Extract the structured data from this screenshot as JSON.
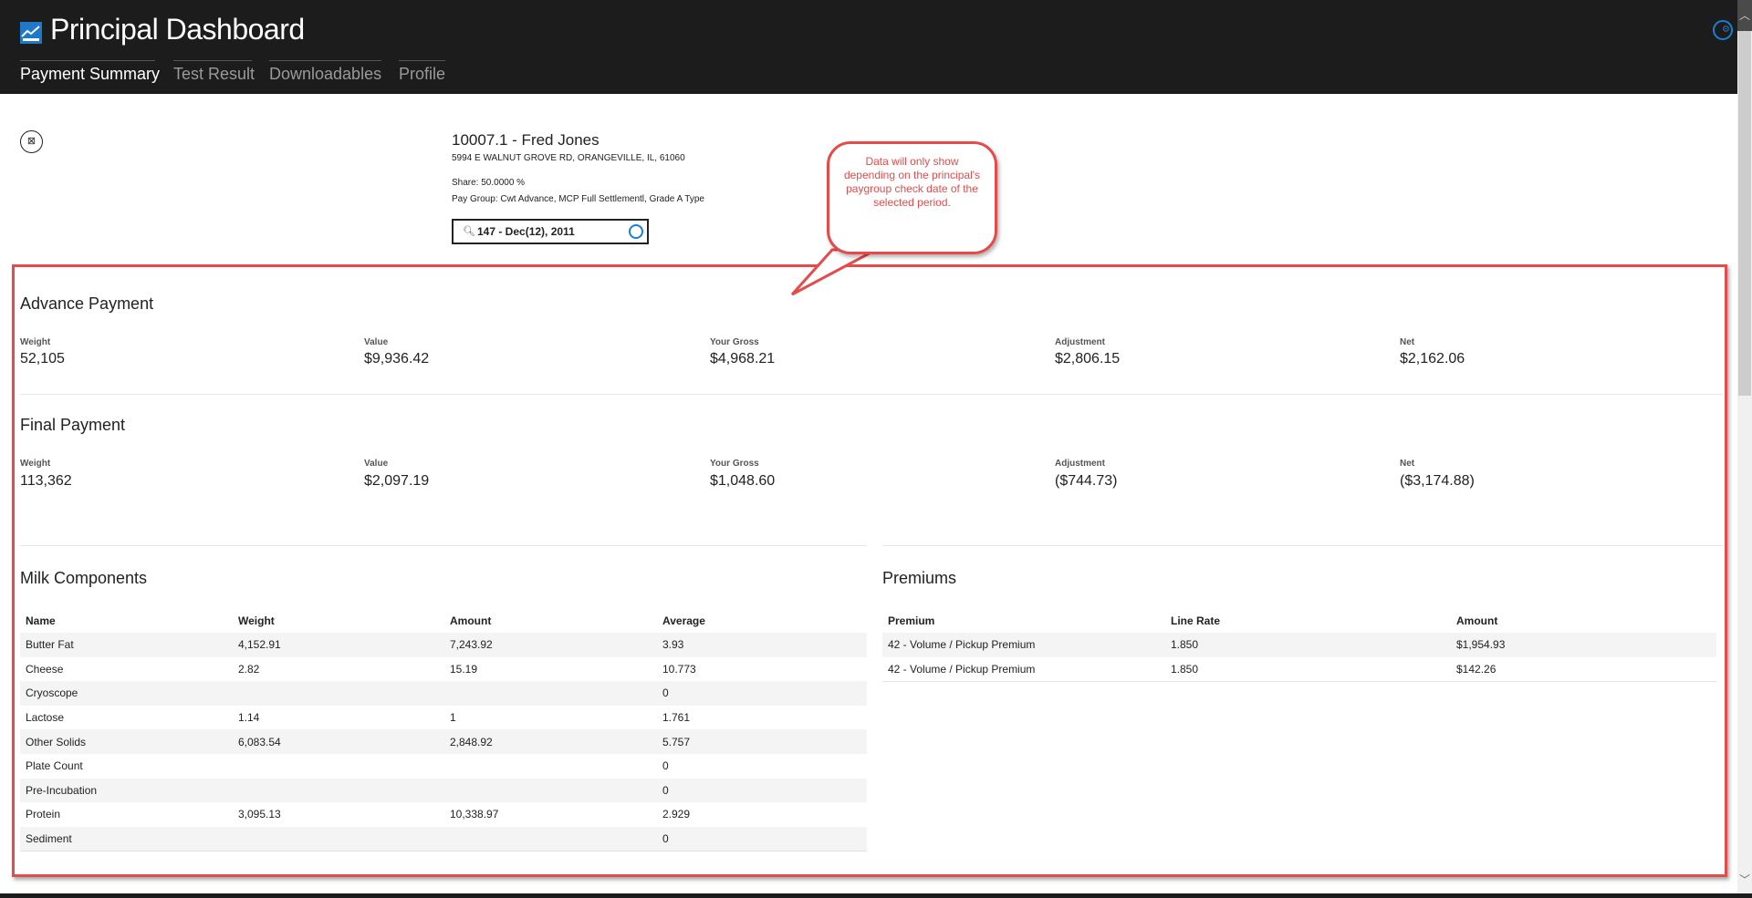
{
  "header": {
    "title": "Principal Dashboard",
    "tabs": [
      {
        "label": "Payment Summary",
        "active": true
      },
      {
        "label": "Test Result"
      },
      {
        "label": "Downloadables"
      },
      {
        "label": "Profile"
      }
    ]
  },
  "customer": {
    "name": "10007.1 - Fred Jones",
    "address": "5994 E WALNUT GROVE RD, ORANGEVILLE, IL, 61060",
    "share": "Share: 50.0000 %",
    "pay_group": "Pay Group: Cwt Advance, MCP Full Settlementl, Grade A Type",
    "period": "147 - Dec(12), 2011"
  },
  "callout": "Data will only show depending on the principal's paygroup check date of the selected period.",
  "advance": {
    "title": "Advance Payment",
    "fields": [
      {
        "label": "Weight",
        "value": "52,105"
      },
      {
        "label": "Value",
        "value": "$9,936.42"
      },
      {
        "label": "Your Gross",
        "value": "$4,968.21"
      },
      {
        "label": "Adjustment",
        "value": "$2,806.15"
      },
      {
        "label": "Net",
        "value": "$2,162.06"
      }
    ]
  },
  "final": {
    "title": "Final Payment",
    "fields": [
      {
        "label": "Weight",
        "value": "113,362"
      },
      {
        "label": "Value",
        "value": "$2,097.19"
      },
      {
        "label": "Your Gross",
        "value": "$1,048.60"
      },
      {
        "label": "Adjustment",
        "value": "($744.73)"
      },
      {
        "label": "Net",
        "value": "($3,174.88)"
      }
    ]
  },
  "milk": {
    "title": "Milk Components",
    "columns": [
      "Name",
      "Weight",
      "Amount",
      "Average"
    ],
    "rows": [
      [
        "Butter Fat",
        "4,152.91",
        "7,243.92",
        "3.93"
      ],
      [
        "Cheese",
        "2.82",
        "15.19",
        "10.773"
      ],
      [
        "Cryoscope",
        "",
        "",
        "0"
      ],
      [
        "Lactose",
        "1.14",
        "1",
        "1.761"
      ],
      [
        "Other Solids",
        "6,083.54",
        "2,848.92",
        "5.757"
      ],
      [
        "Plate Count",
        "",
        "",
        "0"
      ],
      [
        "Pre-Incubation",
        "",
        "",
        "0"
      ],
      [
        "Protein",
        "3,095.13",
        "10,338.97",
        "2.929"
      ],
      [
        "Sediment",
        "",
        "",
        "0"
      ]
    ]
  },
  "premiums": {
    "title": "Premiums",
    "columns": [
      "Premium",
      "Line Rate",
      "Amount"
    ],
    "rows": [
      [
        "42 - Volume / Pickup Premium",
        "1.850",
        "$1,954.93"
      ],
      [
        "42 - Volume / Pickup Premium",
        "1.850",
        "$142.26"
      ]
    ]
  },
  "colors": {
    "accent": "#1a7fd4",
    "annotation": "#e54b4b",
    "header": "#1c1c1c"
  }
}
